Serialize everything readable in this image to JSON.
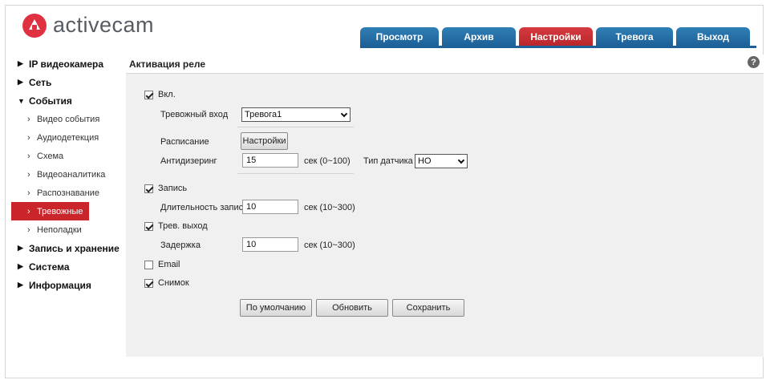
{
  "logo": {
    "text": "activecam"
  },
  "tabs": [
    {
      "label": "Просмотр",
      "active": false
    },
    {
      "label": "Архив",
      "active": false
    },
    {
      "label": "Настройки",
      "active": true
    },
    {
      "label": "Тревога",
      "active": false
    },
    {
      "label": "Выход",
      "active": false
    }
  ],
  "sidebar": {
    "items": [
      {
        "label": "IP видеокамера",
        "level": "top",
        "expanded": false
      },
      {
        "label": "Сеть",
        "level": "top",
        "expanded": false
      },
      {
        "label": "События",
        "level": "top",
        "expanded": true
      },
      {
        "label": "Видео события",
        "level": "sub"
      },
      {
        "label": "Аудиодетекция",
        "level": "sub"
      },
      {
        "label": "Схема",
        "level": "sub"
      },
      {
        "label": "Видеоаналитика",
        "level": "sub"
      },
      {
        "label": "Распознавание",
        "level": "sub"
      },
      {
        "label": "Тревожные",
        "level": "sub",
        "active": true
      },
      {
        "label": "Неполадки",
        "level": "sub"
      },
      {
        "label": "Запись и хранение",
        "level": "top",
        "expanded": false
      },
      {
        "label": "Система",
        "level": "top",
        "expanded": false
      },
      {
        "label": "Информация",
        "level": "top",
        "expanded": false
      }
    ]
  },
  "panel": {
    "title": "Активация реле",
    "help_icon": "?",
    "enable": {
      "label": "Вкл.",
      "checked": true
    },
    "alarm_input": {
      "label": "Тревожный вход",
      "value": "Тревога1"
    },
    "schedule": {
      "label": "Расписание",
      "button": "Настройки"
    },
    "antidither": {
      "label": "Антидизеринг",
      "value": "15",
      "unit": "сек (0~100)"
    },
    "sensor_type": {
      "label": "Тип датчика",
      "value": "НО"
    },
    "record": {
      "label": "Запись",
      "checked": true
    },
    "record_duration": {
      "label": "Длительность записи",
      "value": "10",
      "unit": "сек (10~300)"
    },
    "alarm_out": {
      "label": "Трев. выход",
      "checked": true
    },
    "delay": {
      "label": "Задержка",
      "value": "10",
      "unit": "сек (10~300)"
    },
    "email": {
      "label": "Email",
      "checked": false
    },
    "snapshot": {
      "label": "Снимок",
      "checked": true
    },
    "buttons": {
      "default": "По умолчанию",
      "refresh": "Обновить",
      "save": "Сохранить"
    }
  },
  "colors": {
    "accent_blue": "#1d6097",
    "accent_red": "#c9252b",
    "logo_red": "#e03140"
  }
}
